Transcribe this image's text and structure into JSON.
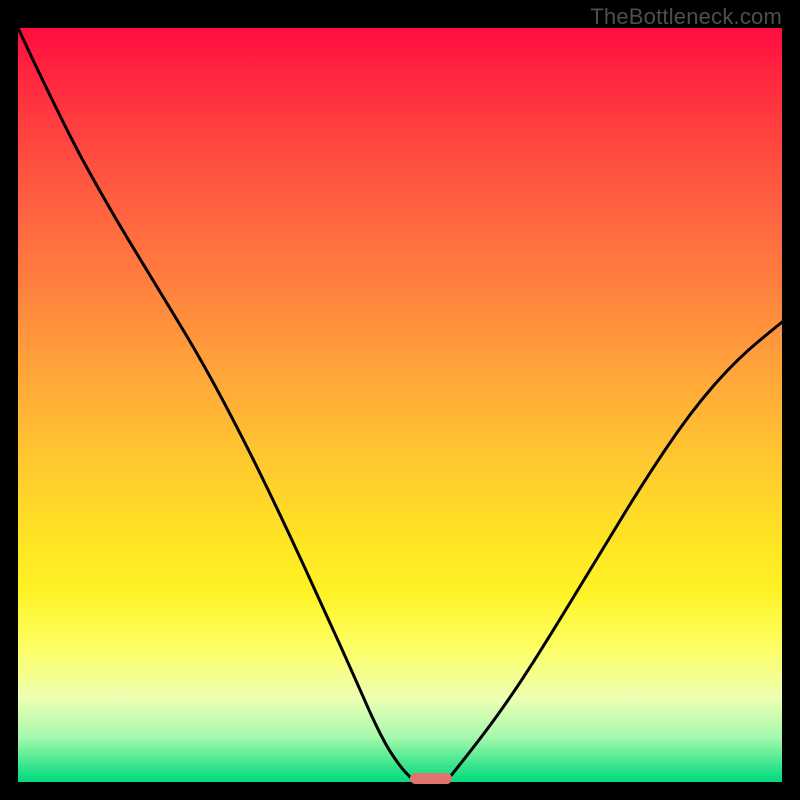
{
  "watermark": "TheBottleneck.com",
  "chart_data": {
    "type": "line",
    "title": "",
    "xlabel": "",
    "ylabel": "",
    "xlim": [
      0,
      1
    ],
    "ylim": [
      0,
      1
    ],
    "series": [
      {
        "name": "left-curve",
        "x": [
          0.0,
          0.06,
          0.12,
          0.18,
          0.24,
          0.3,
          0.35,
          0.4,
          0.44,
          0.475,
          0.5,
          0.52
        ],
        "y": [
          1.0,
          0.87,
          0.76,
          0.66,
          0.56,
          0.445,
          0.34,
          0.23,
          0.14,
          0.06,
          0.02,
          0.0
        ]
      },
      {
        "name": "right-curve",
        "x": [
          0.56,
          0.6,
          0.65,
          0.7,
          0.76,
          0.82,
          0.88,
          0.94,
          1.0
        ],
        "y": [
          0.0,
          0.05,
          0.12,
          0.2,
          0.3,
          0.4,
          0.49,
          0.56,
          0.61
        ]
      }
    ],
    "marker": {
      "x_center": 0.54,
      "y": 0.0,
      "width": 0.055,
      "color": "#e0736f"
    },
    "gradient_stops": [
      {
        "pos": 0.0,
        "color": "#ff0c3e"
      },
      {
        "pos": 0.18,
        "color": "#ff5040"
      },
      {
        "pos": 0.46,
        "color": "#ffa63a"
      },
      {
        "pos": 0.68,
        "color": "#ffe423"
      },
      {
        "pos": 0.82,
        "color": "#fdff62"
      },
      {
        "pos": 0.94,
        "color": "#a6f9ae"
      },
      {
        "pos": 1.0,
        "color": "#00db7e"
      }
    ]
  }
}
